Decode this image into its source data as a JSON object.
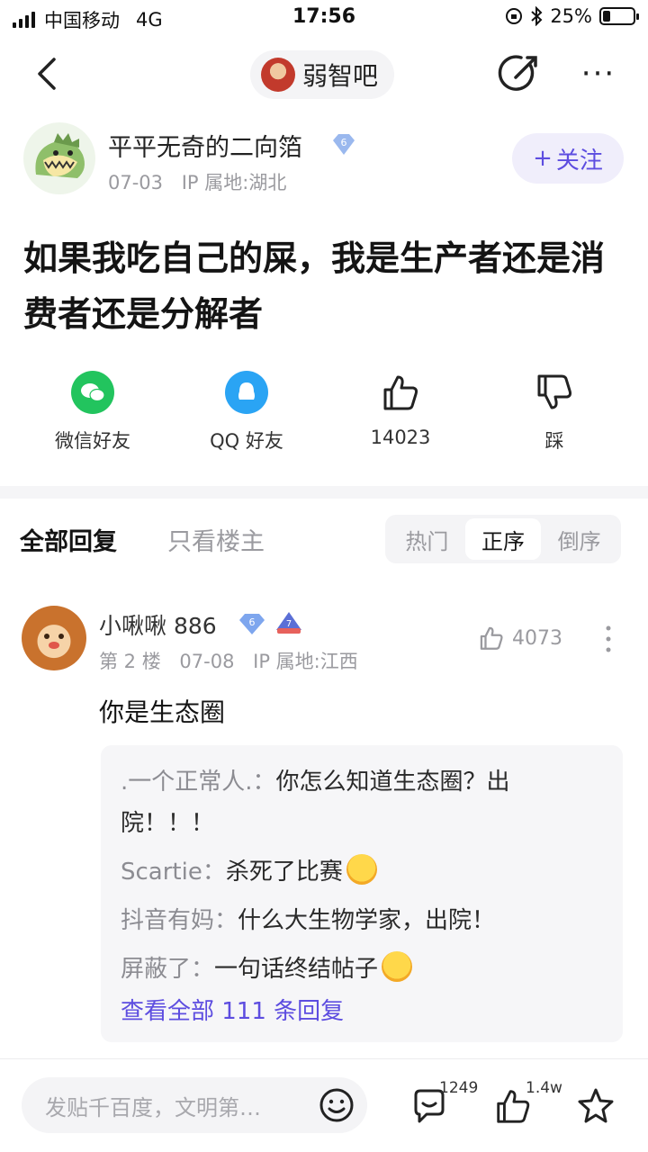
{
  "status_bar": {
    "carrier": "中国移动",
    "network": "4G",
    "time": "17:56",
    "battery": "25%",
    "battery_level": 0.25
  },
  "nav": {
    "forum_name": "弱智吧"
  },
  "author": {
    "name": "平平无奇的二向箔",
    "level": "6",
    "date": "07-03",
    "ip": "IP 属地:湖北",
    "follow_label": "关注"
  },
  "post": {
    "title": "如果我吃自己的屎，我是生产者还是消费者还是分解者"
  },
  "actions": {
    "wechat": "微信好友",
    "qq": "QQ 好友",
    "like_count": "14023",
    "dislike": "踩"
  },
  "tabs": {
    "all": "全部回复",
    "owner_only": "只看楼主",
    "sort": [
      "热门",
      "正序",
      "倒序"
    ],
    "sort_active": 1
  },
  "reply": {
    "name": "小啾啾 886",
    "level": "6",
    "rank": "7",
    "floor": "第 2 楼",
    "date": "07-08",
    "ip": "IP 属地:江西",
    "likes": "4073",
    "text": "你是生态圈",
    "sub_replies": [
      {
        "who": ".一个正常人.：",
        "text": "你怎么知道生态圈？出院！！！"
      },
      {
        "who": "Scartie：",
        "text": "杀死了比赛"
      },
      {
        "who": "抖音有妈：",
        "text": "什么大生物学家，出院！"
      },
      {
        "who": "屏蔽了：",
        "text": "一句话终结帖子"
      }
    ],
    "view_all": "查看全部 111 条回复"
  },
  "bottom_bar": {
    "input_placeholder": "发贴千百度，文明第…",
    "comment_count": "1249",
    "like_count": "1.4w"
  }
}
